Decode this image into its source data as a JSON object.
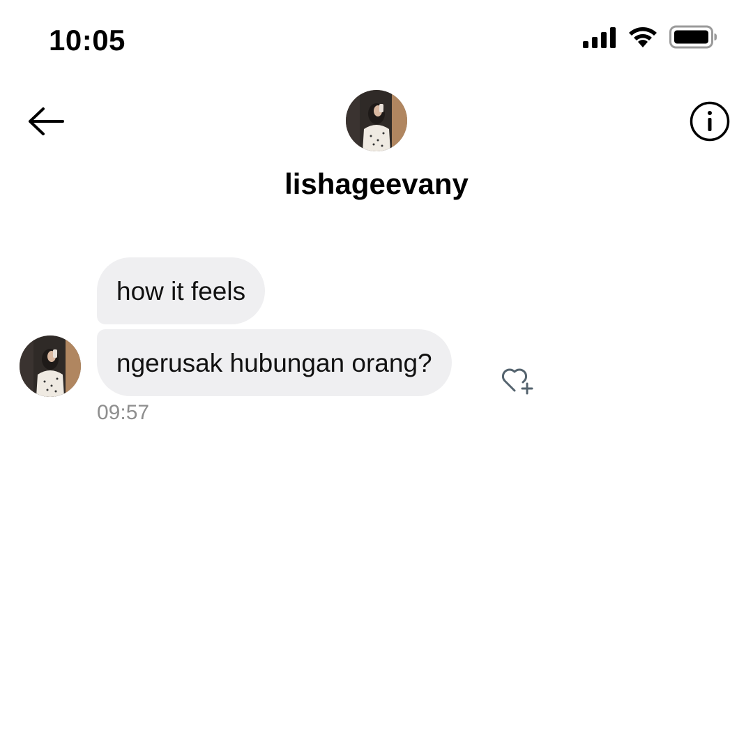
{
  "status_bar": {
    "time": "10:05",
    "icons": [
      "cellular-signal-icon",
      "wifi-icon",
      "battery-icon"
    ]
  },
  "header": {
    "back_icon": "arrow-left-icon",
    "avatar": "profile-photo",
    "username": "lishageevany",
    "info_icon": "info-icon"
  },
  "messages": [
    {
      "text": "how it feels"
    },
    {
      "text": "ngerusak hubungan orang?"
    }
  ],
  "message_meta": {
    "timestamp": "09:57",
    "react_icon": "heart-plus-icon"
  },
  "colors": {
    "bubble_bg": "#efeff1",
    "timestamp": "#8e8e8e",
    "react_icon": "#54636e"
  }
}
